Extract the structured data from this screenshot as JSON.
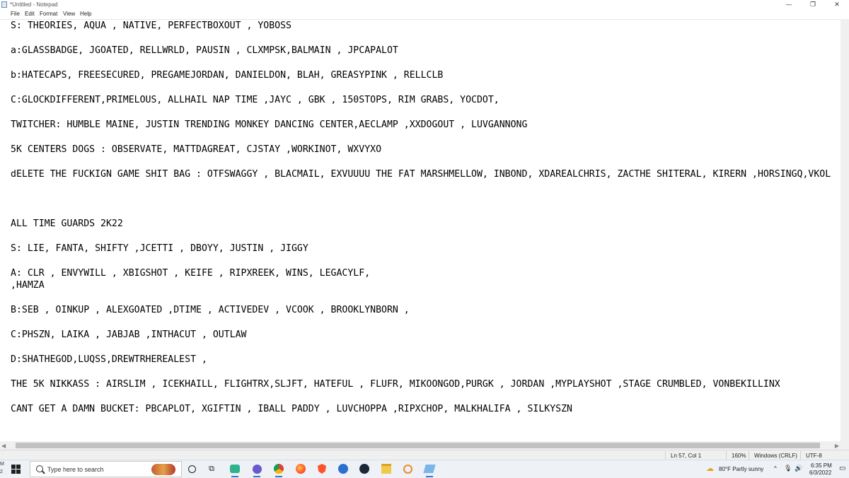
{
  "window": {
    "title": "*Untitled - Notepad",
    "controls": {
      "minimize": "—",
      "maximize": "❐",
      "close": "✕"
    }
  },
  "menu": [
    "File",
    "Edit",
    "Format",
    "View",
    "Help"
  ],
  "editor": {
    "lines": [
      "S: THEORIES, AQUA , NATIVE, PERFECTBOXOUT , YOBOSS",
      "a:GLASSBADGE, JGOATED, RELLWRLD, PAUSIN , CLXMPSK,BALMAIN , JPCAPALOT",
      "b:HATECAPS, FREESECURED, PREGAMEJORDAN, DANIELDON, BLAH, GREASYPINK , RELLCLB",
      "C:GLOCKDIFFERENT,PRIMELOUS, ALLHAIL NAP TIME ,JAYC , GBK , 150STOPS, RIM GRABS, YOCDOT,",
      "TWITCHER: HUMBLE MAINE, JUSTIN TRENDING MONKEY DANCING CENTER,AECLAMP ,XXDOGOUT , LUVGANNONG",
      "5K CENTERS DOGS : OBSERVATE, MATTDAGREAT, CJSTAY ,WORKINOT, WXVYXO",
      "dELETE THE FUCKIGN GAME SHIT BAG : OTFSWAGGY , BLACMAIL, EXVUUUU THE FAT MARSHMELLOW, INBOND, XDAREALCHRIS, ZACTHE SHITERAL, KIRERN ,HORSINGQ,VKOL",
      "ALL TIME GUARDS 2K22",
      "S: LIE, FANTA, SHIFTY ,JCETTI , DBOYY, JUSTIN , JIGGY",
      "A: CLR , ENVYWILL , XBIGSHOT , KEIFE , RIPXREEK, WINS, LEGACYLF,",
      ",HAMZA",
      "B:SEB , OINKUP , ALEXGOATED ,DTIME , ACTIVEDEV , VCOOK , BROOKLYNBORN ,",
      "C:PHSZN, LAIKA , JABJAB ,INTHACUT , OUTLAW",
      "D:SHATHEGOD,LUQSS,DREWTRHEREALEST ,",
      "THE 5K NIKKASS : AIRSLIM , ICEKHAILL, FLIGHTRX,SLJFT, HATEFUL , FLUFR, MIKOONGOD,PURGK , JORDAN ,MYPLAYSHOT ,STAGE CRUMBLED, VONBEKILLINX",
      "CANT GET A DAMN BUCKET: PBCAPLOT, XGIFTIN , IBALL PADDY , LUVCHOPPA ,RIPXCHOP, MALKHALIFA , SILKYSZN"
    ]
  },
  "status": {
    "position": "Ln 57, Col 1",
    "zoom": "160%",
    "line_ending": "Windows (CRLF)",
    "encoding": "UTF-8"
  },
  "taskbar": {
    "search_placeholder": "Type here to search",
    "edge_top": "M",
    "edge_bottom": "2",
    "weather": "80°F  Partly sunny",
    "time": "6:35 PM",
    "date": "6/3/2022",
    "icons": [
      "windows-start-icon",
      "search-icon",
      "task-view-icon",
      "widgets-icon",
      "meet-icon",
      "chrome-icon",
      "firefox-icon",
      "brave-icon",
      "vpn-icon",
      "steam-icon",
      "file-explorer-icon",
      "app-icon",
      "notepad-icon"
    ]
  }
}
